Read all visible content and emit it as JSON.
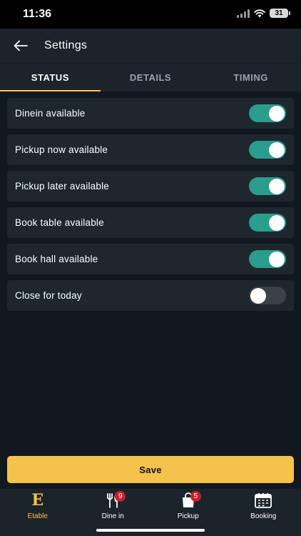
{
  "status_bar": {
    "time": "11:36",
    "battery": "31"
  },
  "header": {
    "title": "Settings",
    "back_icon": "arrow-left-icon"
  },
  "tabs": [
    {
      "label": "STATUS",
      "active": true
    },
    {
      "label": "DETAILS",
      "active": false
    },
    {
      "label": "TIMING",
      "active": false
    }
  ],
  "settings": [
    {
      "label": "Dinein available",
      "enabled": true
    },
    {
      "label": "Pickup now available",
      "enabled": true
    },
    {
      "label": "Pickup later available",
      "enabled": true
    },
    {
      "label": "Book table available",
      "enabled": true
    },
    {
      "label": "Book hall available",
      "enabled": true
    },
    {
      "label": "Close for today",
      "enabled": false
    }
  ],
  "save_label": "Save",
  "bottom_nav": [
    {
      "label": "Etable",
      "icon": "etable-logo-icon",
      "active": true
    },
    {
      "label": "Dine in",
      "icon": "fork-knife-icon",
      "badge": "9"
    },
    {
      "label": "Pickup",
      "icon": "shopping-bag-icon",
      "badge": "5"
    },
    {
      "label": "Booking",
      "icon": "calendar-icon"
    }
  ],
  "colors": {
    "accent": "#f5c24b",
    "toggle_on": "#2a9d8c",
    "badge": "#c9202a",
    "background": "#111820",
    "card": "#1e262e"
  }
}
